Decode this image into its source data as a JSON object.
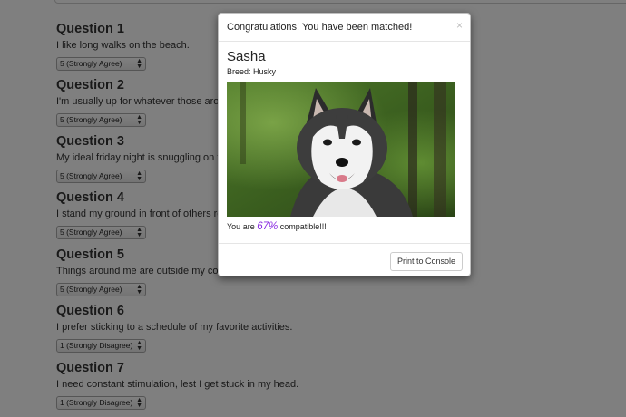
{
  "questions": [
    {
      "title": "Question 1",
      "text": "I like long walks on the beach.",
      "selected": "5 (Strongly Agree)"
    },
    {
      "title": "Question 2",
      "text": "I'm usually up for whatever those arou",
      "selected": "5 (Strongly Agree)"
    },
    {
      "title": "Question 3",
      "text": "My ideal friday night is snuggling on th",
      "selected": "5 (Strongly Agree)"
    },
    {
      "title": "Question 4",
      "text": "I stand my ground in front of others re",
      "selected": "5 (Strongly Agree)"
    },
    {
      "title": "Question 5",
      "text": "Things around me are outside my cont",
      "selected": "5 (Strongly Agree)"
    },
    {
      "title": "Question 6",
      "text": "I prefer sticking to a schedule of my favorite activities.",
      "selected": "1 (Strongly Disagree)"
    },
    {
      "title": "Question 7",
      "text": "I need constant stimulation, lest I get stuck in my head.",
      "selected": "1 (Strongly Disagree)"
    }
  ],
  "modal": {
    "title": "Congratulations! You have been matched!",
    "close": "×",
    "name": "Sasha",
    "breed": "Breed: Husky",
    "compat_prefix": "You are ",
    "compat_percent": "67%",
    "compat_suffix": " compatible!!!",
    "print_button": "Print to Console"
  },
  "icons": {
    "select_arrows": "up-down-arrows-icon",
    "close": "close-icon"
  },
  "colors": {
    "overlay": "#000000",
    "accent_percent": "#8a2be2"
  }
}
